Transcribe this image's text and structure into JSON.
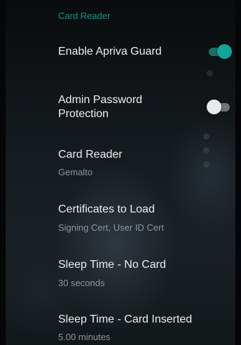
{
  "section": {
    "header": "Card Reader"
  },
  "settings": [
    {
      "title": "Enable Apriva Guard",
      "toggle": true
    },
    {
      "title_line1": "Admin Password",
      "title_line2": "Protection",
      "toggle": false
    },
    {
      "title": "Card Reader",
      "summary": "Gemalto"
    },
    {
      "title": "Certificates to Load",
      "summary": "Signing Cert, User ID Cert"
    },
    {
      "title": "Sleep Time - No Card",
      "summary": "30 seconds"
    },
    {
      "title": "Sleep Time - Card Inserted",
      "summary": "5.00 minutes"
    }
  ],
  "colors": {
    "accent": "#14a59a",
    "section_header": "#1f8f86",
    "title_text": "#eceff0",
    "summary_text": "#8c969b"
  }
}
